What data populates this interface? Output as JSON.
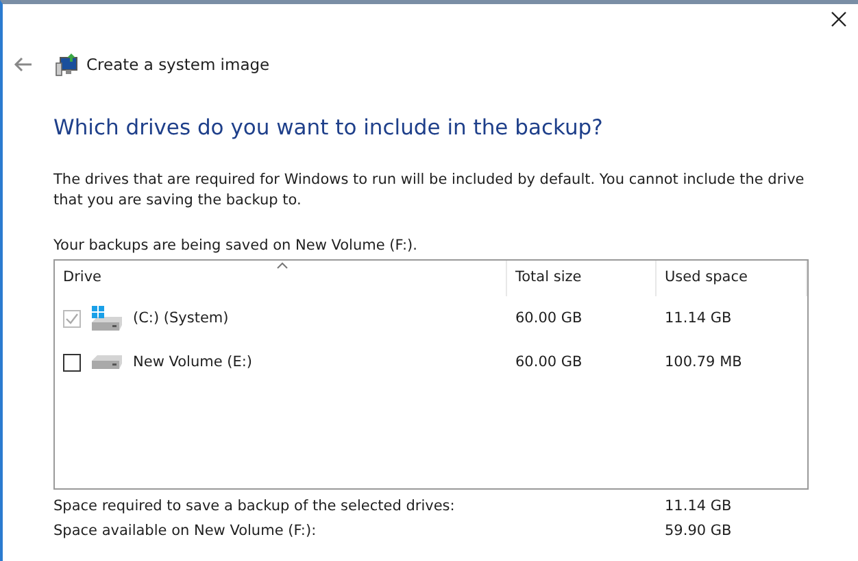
{
  "window": {
    "title": "Create a system image"
  },
  "heading": "Which drives do you want to include in the backup?",
  "description": "The drives that are required for Windows to run will be included by default. You cannot include the drive that you are saving the backup to.",
  "save_location": "Your backups are being saved on New Volume (F:).",
  "table": {
    "columns": [
      "Drive",
      "Total size",
      "Used space"
    ],
    "rows": [
      {
        "drive": "(C:) (System)",
        "kind": "system",
        "checked": true,
        "disabled": true,
        "total_size": "60.00 GB",
        "used_space": "11.14 GB"
      },
      {
        "drive": "New Volume (E:)",
        "kind": "plain",
        "checked": false,
        "disabled": false,
        "total_size": "60.00 GB",
        "used_space": "100.79 MB"
      }
    ]
  },
  "summary": [
    {
      "label": "Space required to save a backup of the selected drives:",
      "value": "11.14 GB"
    },
    {
      "label": "Space available on New Volume (F:):",
      "value": "59.90 GB"
    }
  ]
}
